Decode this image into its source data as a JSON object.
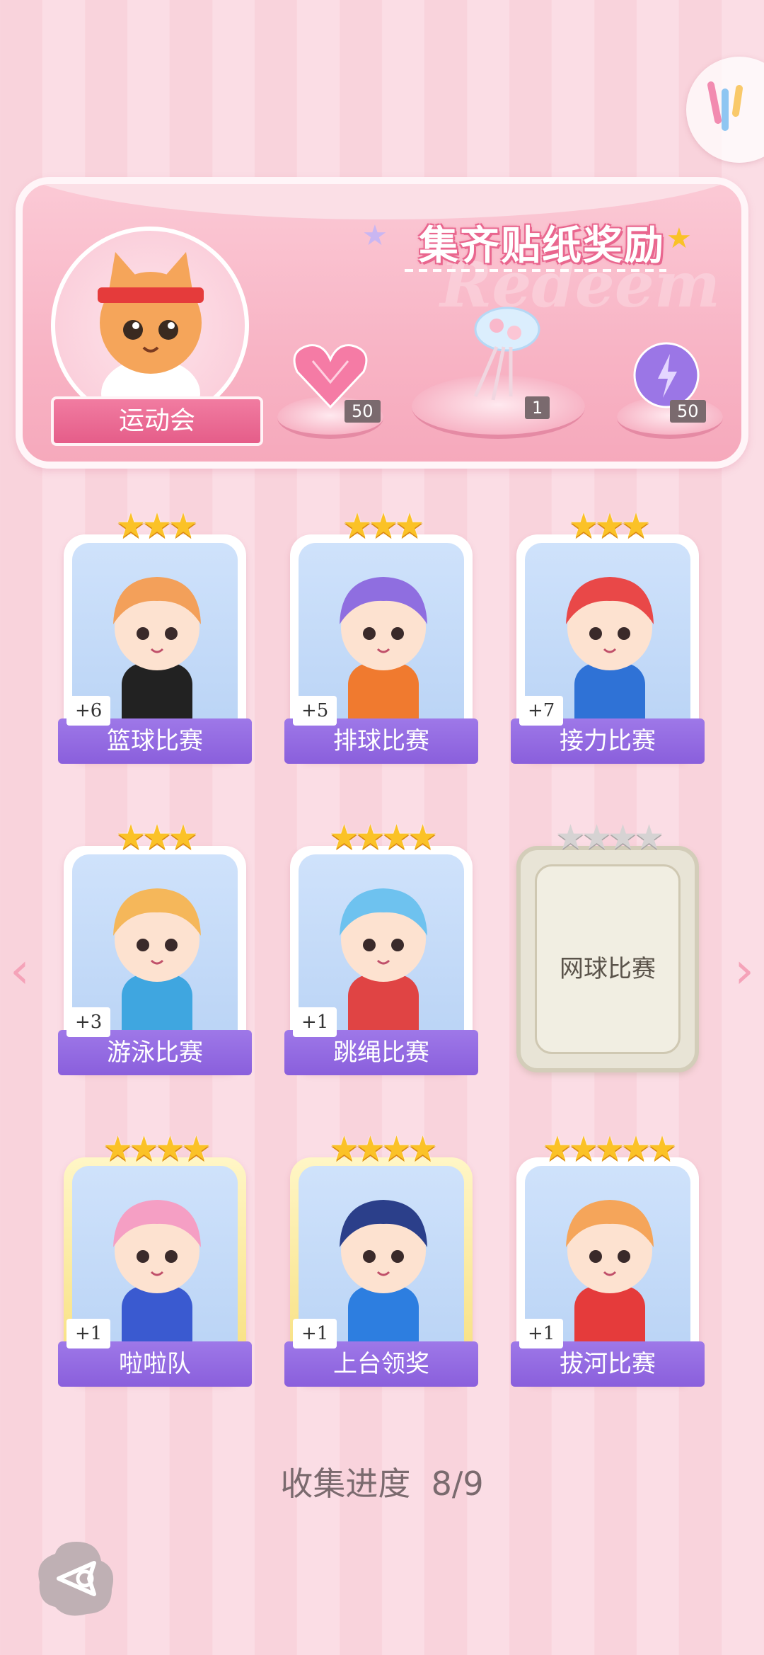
{
  "banner": {
    "title": "集齐贴纸奖励",
    "bg_text": "Redeem",
    "event_name": "运动会",
    "rewards": [
      {
        "name": "pink-heart-gem",
        "count": "50"
      },
      {
        "name": "crystal-bouquet",
        "count": "1"
      },
      {
        "name": "purple-energy-orb",
        "count": "50"
      }
    ]
  },
  "stickers": [
    {
      "name": "篮球比赛",
      "bonus": "+6",
      "stars": 3,
      "max_stars": 3,
      "unlocked": true,
      "frame": "white"
    },
    {
      "name": "排球比赛",
      "bonus": "+5",
      "stars": 3,
      "max_stars": 3,
      "unlocked": true,
      "frame": "white"
    },
    {
      "name": "接力比赛",
      "bonus": "+7",
      "stars": 3,
      "max_stars": 3,
      "unlocked": true,
      "frame": "white"
    },
    {
      "name": "游泳比赛",
      "bonus": "+3",
      "stars": 3,
      "max_stars": 3,
      "unlocked": true,
      "frame": "white"
    },
    {
      "name": "跳绳比赛",
      "bonus": "+1",
      "stars": 4,
      "max_stars": 4,
      "unlocked": true,
      "frame": "white"
    },
    {
      "name": "网球比赛",
      "bonus": "",
      "stars": 0,
      "max_stars": 4,
      "unlocked": false,
      "frame": "locked"
    },
    {
      "name": "啦啦队",
      "bonus": "+1",
      "stars": 4,
      "max_stars": 4,
      "unlocked": true,
      "frame": "gold"
    },
    {
      "name": "上台领奖",
      "bonus": "+1",
      "stars": 4,
      "max_stars": 4,
      "unlocked": true,
      "frame": "gold"
    },
    {
      "name": "拔河比赛",
      "bonus": "+1",
      "stars": 5,
      "max_stars": 5,
      "unlocked": true,
      "frame": "white"
    }
  ],
  "progress": {
    "label": "收集进度",
    "value": "8/9"
  },
  "nav": {
    "prev": "‹",
    "next": "›"
  },
  "colors": {
    "accent_pink": "#e55d89",
    "label_purple": "#8a5fdc",
    "star_gold": "#fbc227"
  }
}
